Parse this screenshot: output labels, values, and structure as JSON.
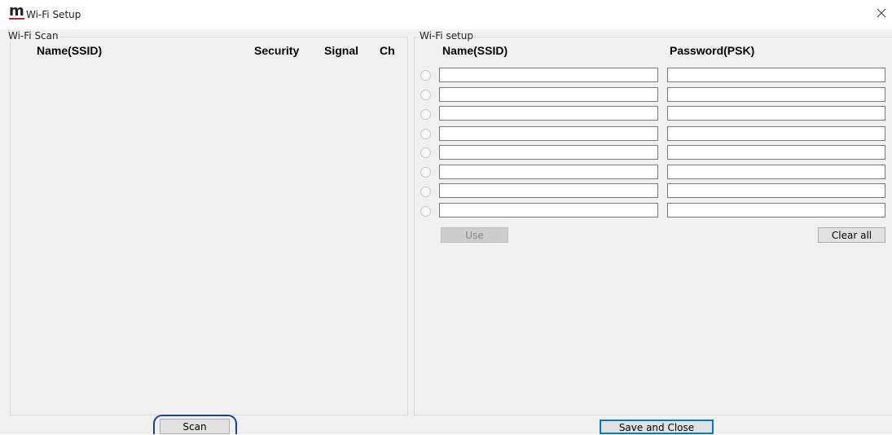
{
  "window": {
    "icon": "m-logo-icon",
    "title": "Wi-Fi Setup"
  },
  "scan_group": {
    "legend": "Wi-Fi Scan",
    "columns": {
      "name": "Name(SSID)",
      "security": "Security",
      "signal": "Signal",
      "channel": "Ch"
    },
    "rows": [],
    "scan_button": "Scan"
  },
  "setup_group": {
    "legend": "Wi-Fi setup",
    "columns": {
      "name": "Name(SSID)",
      "password": "Password(PSK)"
    },
    "entries": [
      {
        "ssid": "",
        "psk": "",
        "selected": false
      },
      {
        "ssid": "",
        "psk": "",
        "selected": false
      },
      {
        "ssid": "",
        "psk": "",
        "selected": false
      },
      {
        "ssid": "",
        "psk": "",
        "selected": false
      },
      {
        "ssid": "",
        "psk": "",
        "selected": false
      },
      {
        "ssid": "",
        "psk": "",
        "selected": false
      },
      {
        "ssid": "",
        "psk": "",
        "selected": false
      },
      {
        "ssid": "",
        "psk": "",
        "selected": false
      }
    ],
    "use_button": "Use",
    "clear_all_button": "Clear all"
  },
  "footer": {
    "save_close_button": "Save and Close"
  },
  "colors": {
    "dialog_bg": "#f0f0f0",
    "focus_ring": "#1c3f9c",
    "default_button_border": "#0078d7",
    "logo_accent": "#c0242c"
  }
}
